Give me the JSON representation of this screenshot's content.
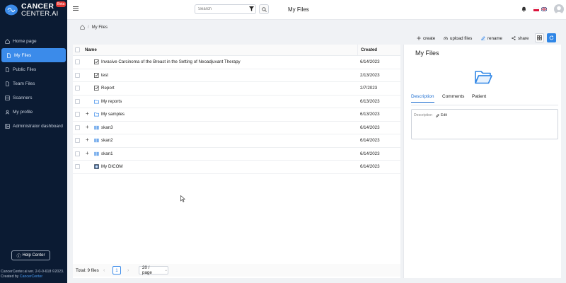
{
  "app": {
    "logo_line1": "CANCER",
    "logo_line2": "CENTER.AI",
    "beta_badge": "Beta",
    "accent_color": "#3b8bea"
  },
  "sidebar": {
    "items": [
      {
        "label": "Home page",
        "icon": "home-icon",
        "active": false
      },
      {
        "label": "My Files",
        "icon": "file-icon",
        "active": true
      },
      {
        "label": "Public Files",
        "icon": "file-icon",
        "active": false
      },
      {
        "label": "Team Files",
        "icon": "file-icon",
        "active": false
      },
      {
        "label": "Scanners",
        "icon": "scanner-icon",
        "active": false
      },
      {
        "label": "My profile",
        "icon": "user-icon",
        "active": false
      },
      {
        "label": "Administrator dashboard",
        "icon": "dashboard-icon",
        "active": false
      }
    ],
    "help_label": "Help Center",
    "footer_line1": "CancerCenter.ai ver. 2-0-0-618 ©2023.",
    "footer_line2_prefix": "Created by ",
    "footer_line2_link": "CancerCenter"
  },
  "topbar": {
    "search_placeholder": "Search",
    "page_title": "My Files"
  },
  "breadcrumb": {
    "current": "My Files"
  },
  "toolbar": {
    "create": "create",
    "upload": "upload files",
    "rename": "rename",
    "share": "share"
  },
  "table": {
    "col_name": "Name",
    "col_created": "Created",
    "rows": [
      {
        "name": "Invasive Carcinoma of the Breast in the Setting of Neoadjuvant Therapy",
        "type": "report",
        "created": "6/14/2023",
        "expandable": false
      },
      {
        "name": "test",
        "type": "report",
        "created": "2/13/2023",
        "expandable": false
      },
      {
        "name": "Report",
        "type": "report",
        "created": "2/7/2023",
        "expandable": false
      },
      {
        "name": "My reports",
        "type": "folder",
        "created": "6/13/2023",
        "expandable": false
      },
      {
        "name": "My samples",
        "type": "folder",
        "created": "6/13/2023",
        "expandable": true
      },
      {
        "name": "skan3",
        "type": "scan",
        "created": "6/14/2023",
        "expandable": true
      },
      {
        "name": "skan2",
        "type": "scan",
        "created": "6/14/2023",
        "expandable": true
      },
      {
        "name": "skan1",
        "type": "scan",
        "created": "6/14/2023",
        "expandable": true
      },
      {
        "name": "My DICOM",
        "type": "dicom",
        "created": "6/14/2023",
        "expandable": false
      }
    ]
  },
  "pagination": {
    "total": "Total: 9 files",
    "current_page": "1",
    "page_size": "20 / page"
  },
  "detail": {
    "title": "My Files",
    "tabs": [
      "Description",
      "Comments",
      "Patient"
    ],
    "active_tab": "Description",
    "description_label": "Description",
    "edit_label": "Edit"
  }
}
